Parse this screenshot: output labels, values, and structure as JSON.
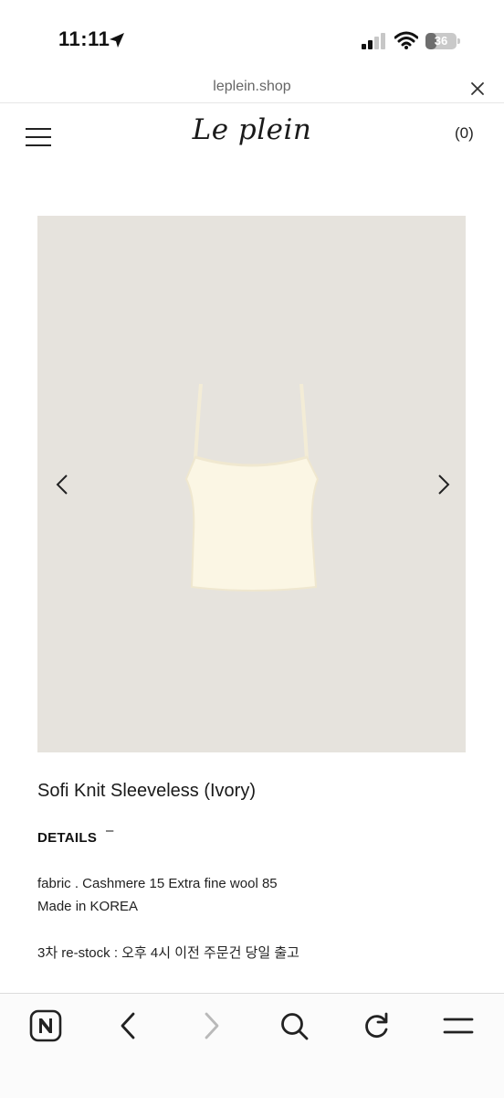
{
  "status_bar": {
    "time": "11:11",
    "battery": "36",
    "battery_level": 0.36,
    "icons": [
      "location-arrow-icon",
      "cellular-signal-icon",
      "wifi-icon",
      "battery-icon"
    ]
  },
  "browser": {
    "url": "leplein.shop",
    "toolbar_icons": [
      "naver-home-icon",
      "back-icon",
      "forward-icon",
      "search-icon",
      "reload-icon",
      "menu-icon"
    ]
  },
  "header": {
    "logo": "Le plein",
    "cart": "(0)",
    "menu_icon": "hamburger-menu-icon"
  },
  "product": {
    "image_background": "#e6e3dd",
    "item_color": "#fbf6e4",
    "title": "Sofi Knit Sleeveless (Ivory)",
    "details_label": "DETAILS",
    "details_toggle": "–",
    "description": [
      "fabric . Cashmere 15 Extra fine wool 85",
      "Made in KOREA",
      "3차 re-stock : 오후 4시 이전 주문건 당일 출고"
    ]
  }
}
